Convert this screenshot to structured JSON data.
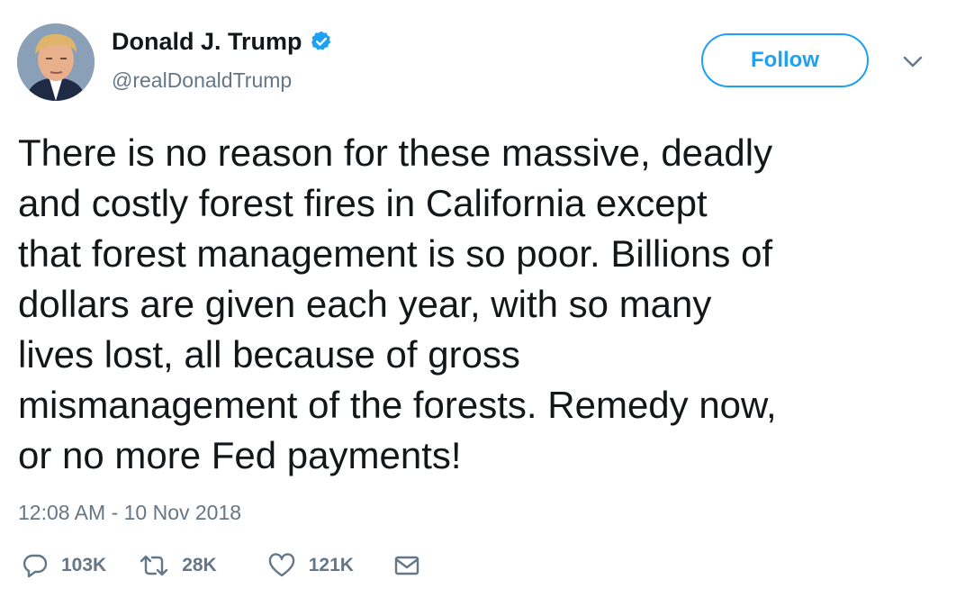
{
  "author": {
    "display_name": "Donald J. Trump",
    "handle": "@realDonaldTrump",
    "verified": true
  },
  "follow_button": {
    "label": "Follow"
  },
  "tweet": {
    "text": "There is no reason for these massive, deadly\nand costly forest fires in California except\nthat forest management is so poor. Billions of\ndollars are given each year, with so many\nlives lost, all because of gross\nmismanagement of the forests. Remedy now,\nor no more Fed payments!",
    "timestamp": "12:08 AM - 10 Nov 2018"
  },
  "actions": {
    "reply": {
      "icon": "reply-icon",
      "count": "103K"
    },
    "retweet": {
      "icon": "retweet-icon",
      "count": "28K"
    },
    "like": {
      "icon": "heart-icon",
      "count": "121K"
    },
    "dm": {
      "icon": "envelope-icon"
    }
  },
  "colors": {
    "accent": "#1da1f2",
    "text": "#14171a",
    "secondary": "#657786"
  }
}
